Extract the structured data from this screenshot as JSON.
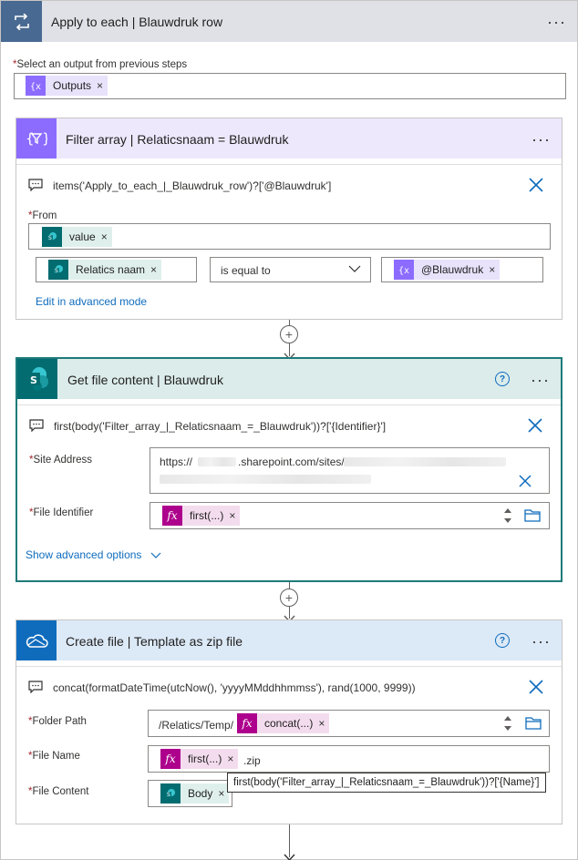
{
  "loop": {
    "title": "Apply to each | Blauwdruk row",
    "menu": "···",
    "select_label": "Select an output from previous steps",
    "output_token": "Outputs"
  },
  "filter": {
    "title": "Filter array | Relaticsnaam = Blauwdruk",
    "menu": "···",
    "expression": "items('Apply_to_each_|_Blauwdruk_row')?['@Blauwdruk']",
    "from_label": "From",
    "from_token": "value",
    "left_token": "Relatics naam",
    "operator": "is equal to",
    "right_token": "@Blauwdruk",
    "advanced_link": "Edit in advanced mode"
  },
  "getfile": {
    "title": "Get file content | Blauwdruk",
    "help": "?",
    "menu": "···",
    "expression": "first(body('Filter_array_|_Relaticsnaam_=_Blauwdruk'))?['{Identifier}']",
    "site_label": "Site Address",
    "site_prefix": "https://",
    "site_middle": ".sharepoint.com/sites/",
    "file_id_label": "File Identifier",
    "file_id_token": "first(...)",
    "advanced_link": "Show advanced options"
  },
  "createfile": {
    "title": "Create file | Template as zip file",
    "help": "?",
    "menu": "···",
    "expression": "concat(formatDateTime(utcNow(), 'yyyyMMddhhmmss'), rand(1000, 9999))",
    "folder_label": "Folder Path",
    "folder_prefix": "/Relatics/Temp/",
    "folder_token": "concat(...)",
    "name_label": "File Name",
    "name_token": "first(...)",
    "name_suffix": ".zip",
    "content_label": "File Content",
    "content_token": "Body",
    "tooltip": "first(body('Filter_array_|_Relaticsnaam_=_Blauwdruk'))?['{Name}']"
  },
  "colors": {
    "loop_accent": "#486991",
    "filter_accent": "#8c6cff",
    "sharepoint_accent": "#036c70",
    "onedrive_accent": "#0f6cbd"
  }
}
